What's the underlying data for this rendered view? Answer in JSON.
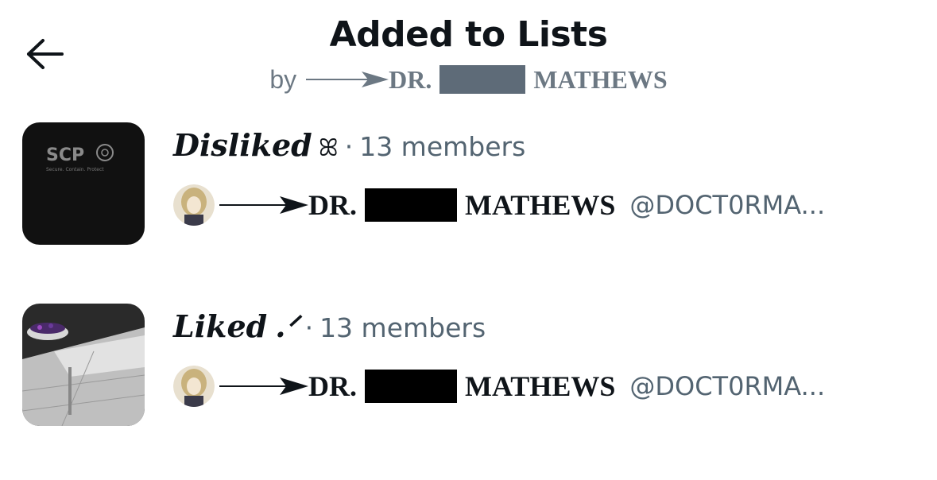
{
  "header": {
    "title": "Added to Lists",
    "by_label": "by",
    "author_prefix": "DR.",
    "author_suffix": "MATHEWS"
  },
  "lists": [
    {
      "name": "Disliked",
      "name_symbol": "ꕤ",
      "separator": "·",
      "members": "13 members",
      "owner_prefix": "DR.",
      "owner_suffix": "MATHEWS",
      "owner_handle": "@DOCT0RMA...",
      "thumb_text": "SCP",
      "thumb_subtext": "Secure. Contain. Protect"
    },
    {
      "name": "Liked",
      "name_symbol": ".ᐟ",
      "separator": "·",
      "members": "13 members",
      "owner_prefix": "DR.",
      "owner_suffix": "MATHEWS",
      "owner_handle": "@DOCT0RMA..."
    }
  ],
  "icons": {
    "back": "back-arrow-icon",
    "arrow": "arrow-decoration-icon",
    "scp_logo": "scp-logo-icon"
  },
  "colors": {
    "text": "#0f1419",
    "secondary": "#536471",
    "redaction_grey": "#5e6b78",
    "redaction_black": "#000000"
  }
}
